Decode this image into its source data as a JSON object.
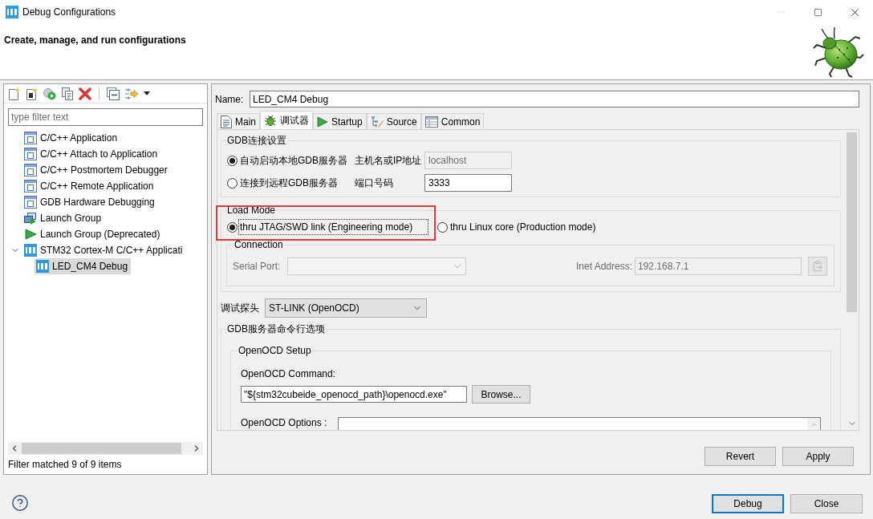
{
  "window": {
    "title": "Debug Configurations",
    "minimize_disabled": true
  },
  "header": {
    "title": "Create, manage, and run configurations"
  },
  "sidebar": {
    "filter": {
      "placeholder": "type filter text"
    },
    "items": [
      {
        "label": "C/C++ Application",
        "kind": "c-app",
        "selected": false
      },
      {
        "label": "C/C++ Attach to Application",
        "kind": "c-app",
        "selected": false
      },
      {
        "label": "C/C++ Postmortem Debugger",
        "kind": "c-app",
        "selected": false
      },
      {
        "label": "C/C++ Remote Application",
        "kind": "c-app",
        "selected": false
      },
      {
        "label": "GDB Hardware Debugging",
        "kind": "c-app",
        "selected": false
      },
      {
        "label": "Launch Group",
        "kind": "launch-group",
        "selected": false
      },
      {
        "label": "Launch Group (Deprecated)",
        "kind": "launch",
        "selected": false
      },
      {
        "label": "STM32 Cortex-M C/C++ Applicati",
        "kind": "ide",
        "selected": false,
        "expanded": true,
        "children": [
          {
            "label": "LED_CM4 Debug",
            "kind": "ide",
            "selected": true
          }
        ]
      }
    ],
    "status": "Filter matched 9 of 9 items"
  },
  "name": {
    "label": "Name:",
    "value": "LED_CM4 Debug"
  },
  "tabs": [
    {
      "label": "Main",
      "kind": "main",
      "selected": false
    },
    {
      "label": "调试器",
      "kind": "debugger",
      "selected": true
    },
    {
      "label": "Startup",
      "kind": "startup",
      "selected": false
    },
    {
      "label": "Source",
      "kind": "source",
      "selected": false
    },
    {
      "label": "Common",
      "kind": "common",
      "selected": false
    }
  ],
  "gdb_connection": {
    "title": "GDB连接设置",
    "options": [
      {
        "label": "自动启动本地GDB服务器",
        "selected": true
      },
      {
        "label": "连接到远程GDB服务器",
        "selected": false
      }
    ],
    "host": {
      "label": "主机名或IP地址",
      "value": "localhost",
      "disabled": true
    },
    "port": {
      "label": "端口号码",
      "value": "3333",
      "disabled": false
    }
  },
  "load_mode": {
    "title": "Load Mode",
    "highlighted": true,
    "options": [
      {
        "label": "thru JTAG/SWD link (Engineering mode)",
        "selected": true,
        "focused": true
      },
      {
        "label": "thru Linux core (Production mode)",
        "selected": false,
        "focused": false
      }
    ],
    "connection": {
      "title": "Connection",
      "disabled": true,
      "serial_port": {
        "label": "Serial Port:"
      },
      "inet_address": {
        "label": "Inet Address:",
        "value": "192.168.7.1"
      }
    }
  },
  "probe": {
    "label": "调试探头",
    "value": "ST-LINK (OpenOCD)"
  },
  "gdb_server_options": {
    "title": "GDB服务器命令行选项",
    "openocd_setup": {
      "title": "OpenOCD Setup",
      "command": {
        "label": "OpenOCD Command:",
        "value": "\"${stm32cubeide_openocd_path}\\openocd.exe\""
      },
      "browse_button": "Browse...",
      "options": {
        "label": "OpenOCD Options :"
      }
    }
  },
  "config_buttons": [
    {
      "label": "Revert",
      "default": false
    },
    {
      "label": "Apply",
      "default": false
    }
  ],
  "dialog_buttons": [
    {
      "label": "Debug",
      "default": true
    },
    {
      "label": "Close",
      "default": false
    }
  ]
}
